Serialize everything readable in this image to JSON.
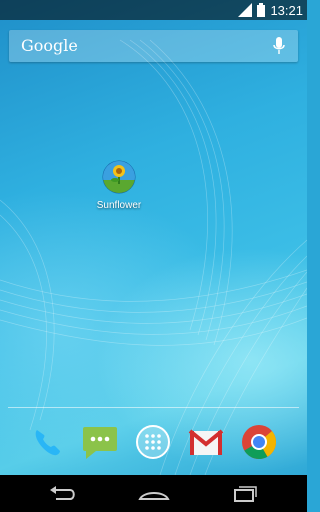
{
  "status_bar": {
    "time": "13:21"
  },
  "search": {
    "label": "Google"
  },
  "home": {
    "apps": [
      {
        "label": "Sunflower"
      }
    ]
  },
  "dock": [
    {
      "name": "phone-icon"
    },
    {
      "name": "messaging-icon"
    },
    {
      "name": "app-drawer-icon"
    },
    {
      "name": "gmail-icon"
    },
    {
      "name": "chrome-icon"
    }
  ],
  "nav": [
    "back-icon",
    "home-icon",
    "recent-apps-icon"
  ]
}
